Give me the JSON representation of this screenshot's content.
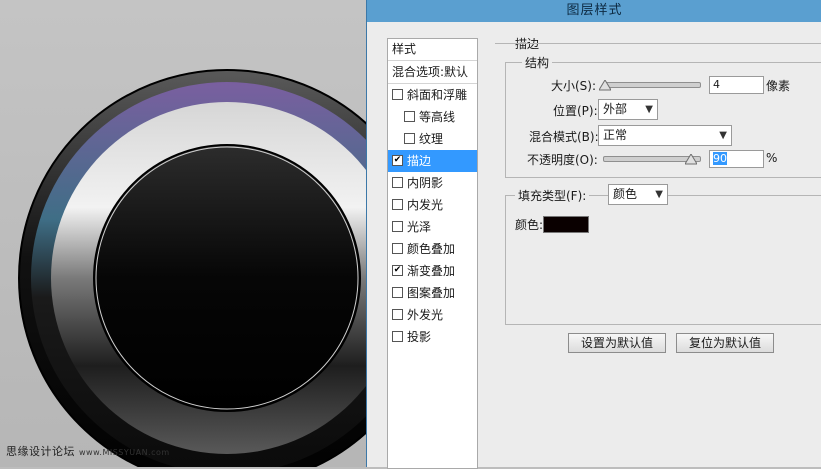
{
  "dialog": {
    "title": "图层样式"
  },
  "style_list": {
    "header": "样式",
    "blend_options": "混合选项:默认",
    "items": [
      {
        "label": "斜面和浮雕",
        "checked": false,
        "sub": false,
        "selected": false
      },
      {
        "label": "等高线",
        "checked": false,
        "sub": true,
        "selected": false
      },
      {
        "label": "纹理",
        "checked": false,
        "sub": true,
        "selected": false
      },
      {
        "label": "描边",
        "checked": true,
        "sub": false,
        "selected": true
      },
      {
        "label": "内阴影",
        "checked": false,
        "sub": false,
        "selected": false
      },
      {
        "label": "内发光",
        "checked": false,
        "sub": false,
        "selected": false
      },
      {
        "label": "光泽",
        "checked": false,
        "sub": false,
        "selected": false
      },
      {
        "label": "颜色叠加",
        "checked": false,
        "sub": false,
        "selected": false
      },
      {
        "label": "渐变叠加",
        "checked": true,
        "sub": false,
        "selected": false
      },
      {
        "label": "图案叠加",
        "checked": false,
        "sub": false,
        "selected": false
      },
      {
        "label": "外发光",
        "checked": false,
        "sub": false,
        "selected": false
      },
      {
        "label": "投影",
        "checked": false,
        "sub": false,
        "selected": false
      }
    ]
  },
  "stroke": {
    "section_title": "描边",
    "structure_title": "结构",
    "size_label": "大小(S):",
    "size_value": "4",
    "size_unit": "像素",
    "size_fraction": 0.02,
    "position_label": "位置(P):",
    "position_value": "外部",
    "blend_label": "混合模式(B):",
    "blend_value": "正常",
    "opacity_label": "不透明度(O):",
    "opacity_value": "90",
    "opacity_unit": "%",
    "opacity_fraction": 0.9,
    "fill_type_label": "填充类型(F):",
    "fill_type_value": "颜色",
    "color_label": "颜色:",
    "color_value": "#0a0000"
  },
  "buttons": {
    "set_default": "设置为默认值",
    "reset_default": "复位为默认值"
  },
  "watermark": {
    "text": "思缘设计论坛",
    "url": "www.MISSYUAN.com"
  }
}
